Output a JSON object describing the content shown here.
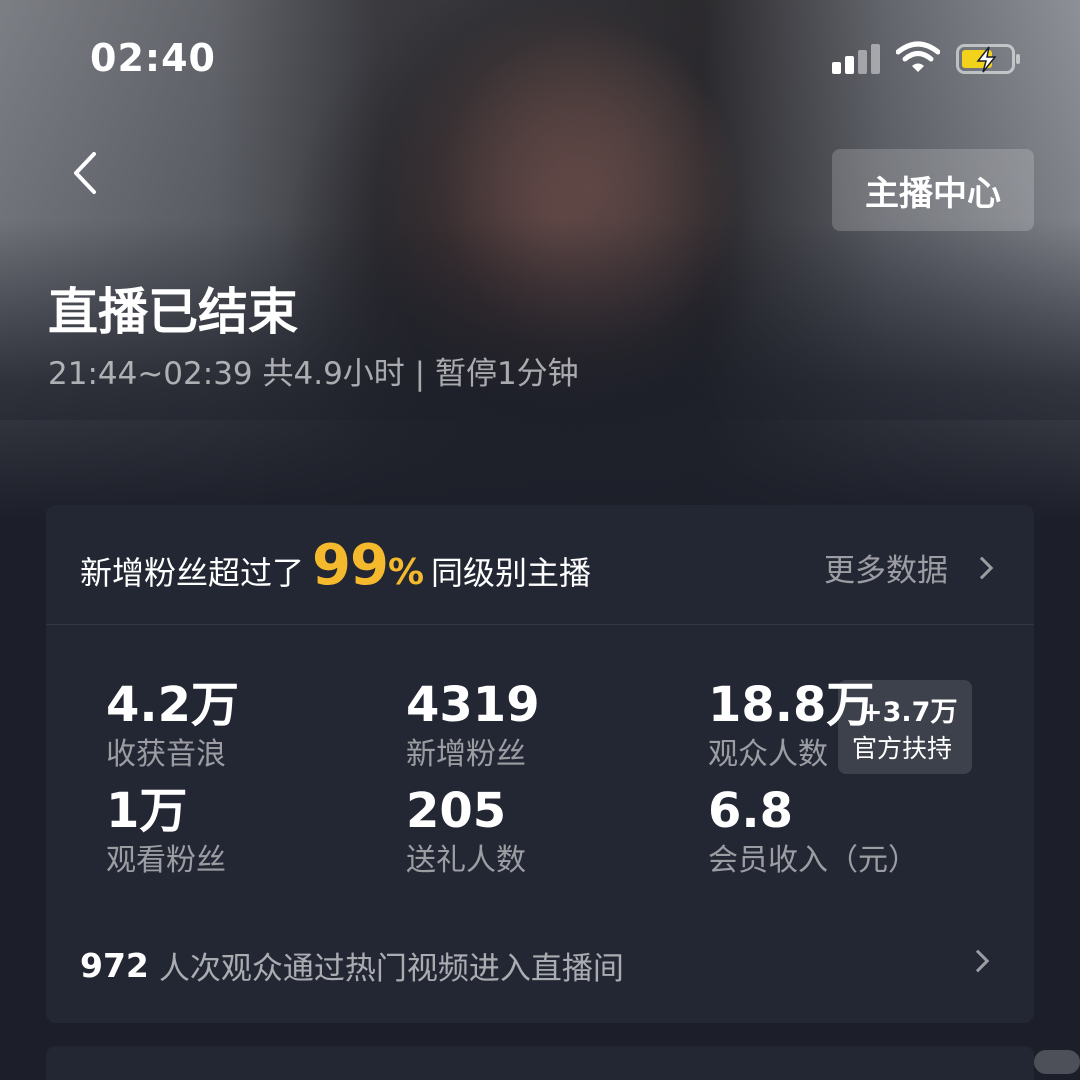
{
  "status": {
    "time": "02:40"
  },
  "header": {
    "center_button": "主播中心"
  },
  "hero": {
    "title": "直播已结束",
    "subtitle": "21:44~02:39 共4.9小时 | 暂停1分钟"
  },
  "card": {
    "headline_prefix": "新增粉丝超过了",
    "headline_pct": "99",
    "headline_pct_unit": "%",
    "headline_suffix": "同级别主播",
    "more_label": "更多数据",
    "stats": [
      {
        "value": "4.2万",
        "label": "收获音浪"
      },
      {
        "value": "4319",
        "label": "新增粉丝"
      },
      {
        "value": "18.8万",
        "label": "观众人数"
      },
      {
        "value": "1万",
        "label": "观看粉丝"
      },
      {
        "value": "205",
        "label": "送礼人数"
      },
      {
        "value": "6.8",
        "label": "会员收入（元）"
      }
    ],
    "support": {
      "value": "+3.7万",
      "label": "官方扶持"
    },
    "bottom_count": "972",
    "bottom_text": "人次观众通过热门视频进入直播间"
  },
  "colors": {
    "accent": "#f5b92d",
    "card_bg": "#232733",
    "page_bg": "#1c1f29",
    "battery": "#f2d21b"
  },
  "icons": [
    "back-chevron-icon",
    "signal-icon",
    "wifi-icon",
    "battery-charging-icon",
    "chevron-right-icon"
  ]
}
